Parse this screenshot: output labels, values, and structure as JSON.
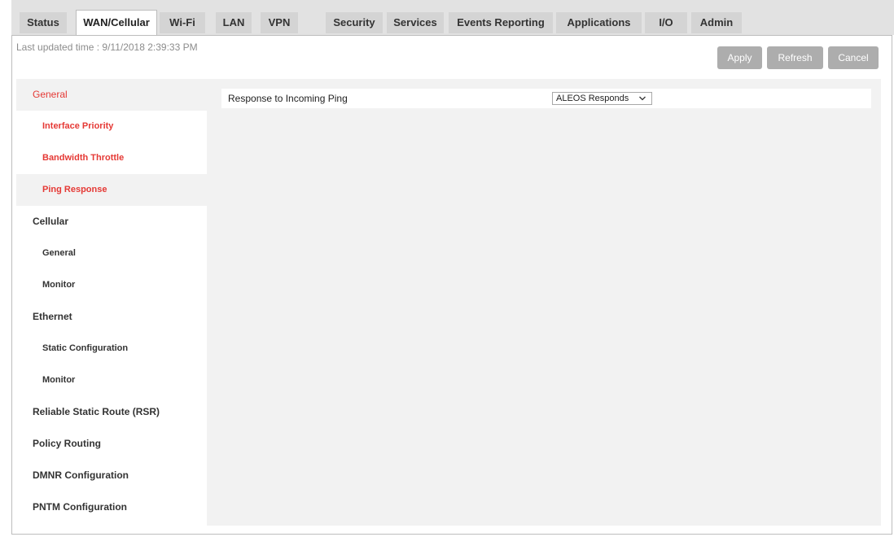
{
  "tabs": [
    {
      "label": "Status",
      "active": false
    },
    {
      "label": "WAN/Cellular",
      "active": true
    },
    {
      "label": "Wi-Fi",
      "active": false
    },
    {
      "label": "LAN",
      "active": false
    },
    {
      "label": "VPN",
      "active": false
    },
    {
      "label": "Security",
      "active": false
    },
    {
      "label": "Services",
      "active": false
    },
    {
      "label": "Events Reporting",
      "active": false
    },
    {
      "label": "Applications",
      "active": false
    },
    {
      "label": "I/O",
      "active": false
    },
    {
      "label": "Admin",
      "active": false
    }
  ],
  "header": {
    "last_updated": "Last updated time : 9/11/2018 2:39:33 PM"
  },
  "toolbar": {
    "apply_label": "Apply",
    "refresh_label": "Refresh",
    "cancel_label": "Cancel"
  },
  "sidebar": {
    "items": [
      {
        "label": "General",
        "level": 1,
        "selected": true
      },
      {
        "label": "Interface Priority",
        "level": 2
      },
      {
        "label": "Bandwidth Throttle",
        "level": 2
      },
      {
        "label": "Ping Response",
        "level": 2,
        "selected": true
      },
      {
        "label": "Cellular",
        "level": 1
      },
      {
        "label": "General",
        "level": 2
      },
      {
        "label": "Monitor",
        "level": 2
      },
      {
        "label": "Ethernet",
        "level": 1
      },
      {
        "label": "Static Configuration",
        "level": 2
      },
      {
        "label": "Monitor",
        "level": 2
      },
      {
        "label": "Reliable Static Route (RSR)",
        "level": 1
      },
      {
        "label": "Policy Routing",
        "level": 1
      },
      {
        "label": "DMNR Configuration",
        "level": 1
      },
      {
        "label": "PNTM Configuration",
        "level": 1
      }
    ]
  },
  "main": {
    "field_label": "Response to Incoming Ping",
    "field_value": "ALEOS Responds"
  },
  "colors": {
    "accent_red": "#e53935",
    "button_gray": "#adadad",
    "panel_gray": "#f2f2f2"
  }
}
